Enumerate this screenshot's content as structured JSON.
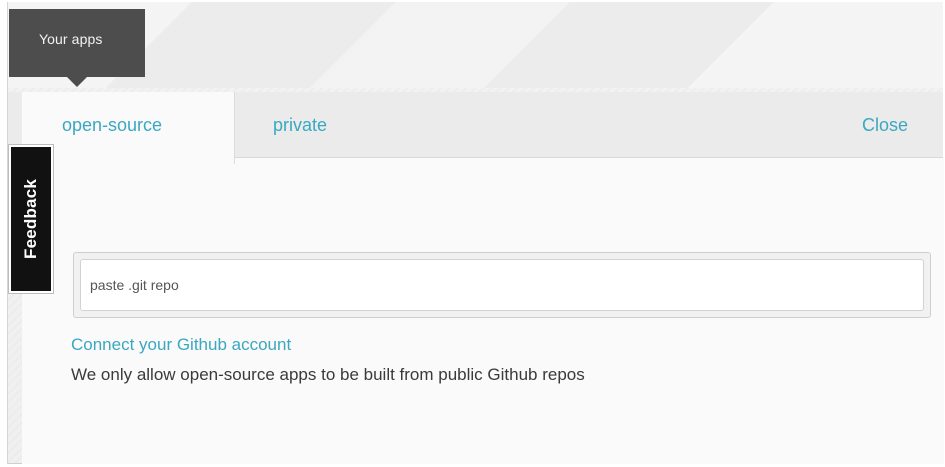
{
  "header": {
    "your_apps_label": "Your apps"
  },
  "tabs": [
    {
      "label": "open-source",
      "active": true
    },
    {
      "label": "private",
      "active": false
    }
  ],
  "close_label": "Close",
  "repo_input": {
    "placeholder": "paste .git repo",
    "value": ""
  },
  "connect_link": "Connect your Github account",
  "note": "We only allow open-source apps to be built from public Github repos",
  "feedback_label": "Feedback",
  "colors": {
    "accent": "#3aa8c0",
    "dark_tab": "#4d4d4d",
    "feedback_bg": "#111111"
  }
}
